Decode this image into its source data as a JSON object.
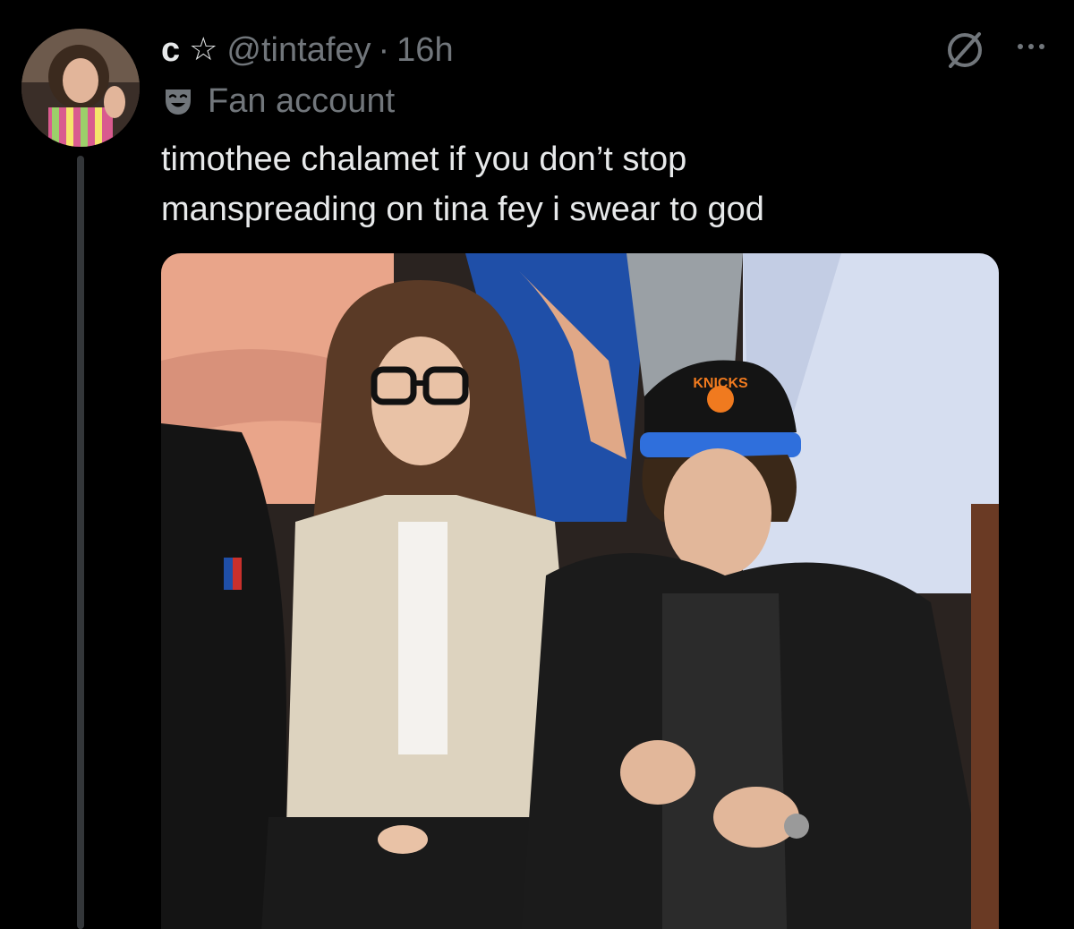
{
  "post": {
    "display_name": "c",
    "star_icon": "☆",
    "handle": "@tintafey",
    "separator": "·",
    "timestamp": "16h",
    "label_icon": "theater-mask-icon",
    "label": "Fan account",
    "text": "timothee chalamet if you don’t stop\nmanspreading on tina fey i swear to god",
    "media": {
      "cap_text": "KNICKS"
    }
  },
  "icons": {
    "grok": "grok-icon",
    "more": "more-icon"
  },
  "colors": {
    "background": "#000000",
    "primary_text": "#e7e9ea",
    "secondary_text": "#71767b",
    "thread_line": "#333639"
  }
}
